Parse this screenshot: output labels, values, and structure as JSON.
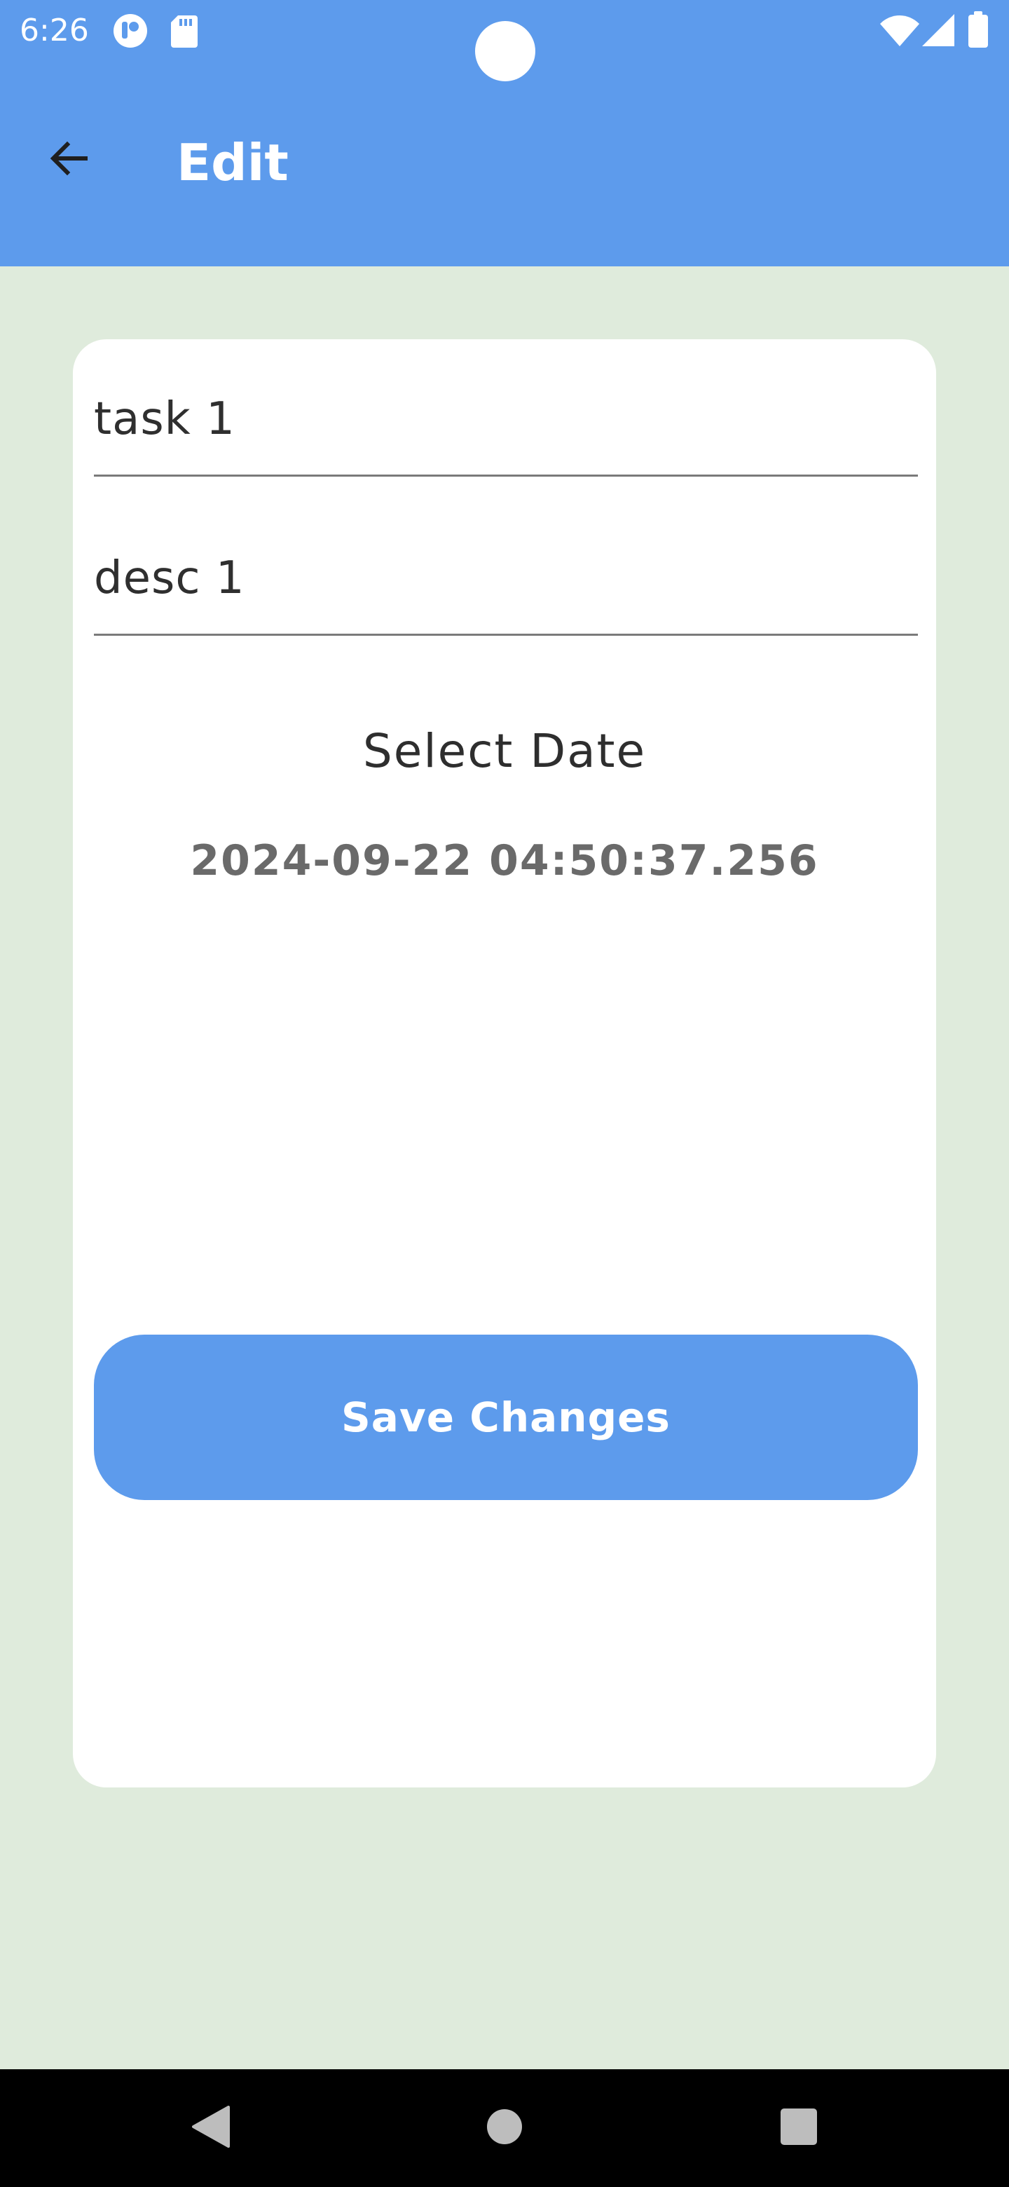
{
  "status_bar": {
    "time": "6:26",
    "icons": [
      "app-notification-icon",
      "sd-card-icon",
      "wifi-icon",
      "cell-signal-icon",
      "battery-icon"
    ]
  },
  "app_bar": {
    "title": "Edit",
    "back_icon": "arrow-back-icon"
  },
  "form": {
    "title_value": "task 1",
    "description_value": "desc 1",
    "select_date_label": "Select Date",
    "selected_date": "2024-09-22 04:50:37.256",
    "save_label": "Save Changes"
  },
  "nav_bar": {
    "icons": [
      "nav-back-icon",
      "nav-home-icon",
      "nav-recents-icon"
    ]
  },
  "colors": {
    "primary": "#5D9BEC",
    "background": "#DFEBDC",
    "card": "#FFFFFF",
    "text_dark": "#2E2E2E",
    "text_muted": "#6A6A6A"
  }
}
